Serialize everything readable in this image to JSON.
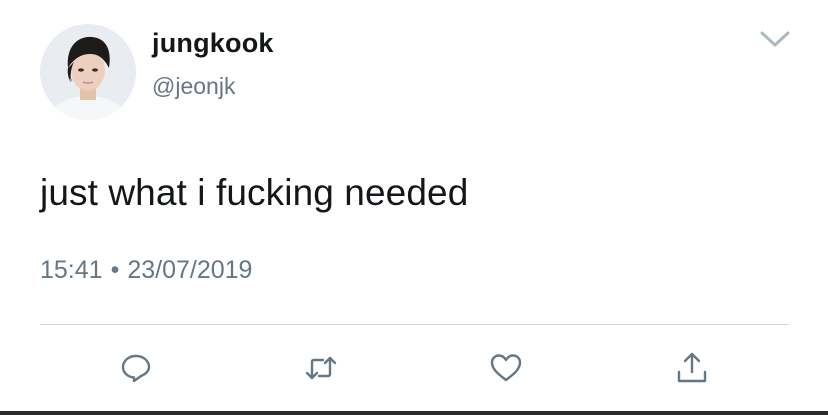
{
  "tweet": {
    "display_name": "jungkook",
    "handle": "@jeonjk",
    "text": "just what i fucking needed",
    "time": "15:41",
    "separator": "•",
    "date": "23/07/2019"
  },
  "icons": {
    "menu": "chevron-down-icon",
    "reply": "reply-icon",
    "retweet": "retweet-icon",
    "like": "heart-icon",
    "share": "share-icon"
  },
  "colors": {
    "text_primary": "#14171a",
    "text_secondary": "#657786",
    "icon": "#657786",
    "divider": "#cfd6dc"
  }
}
